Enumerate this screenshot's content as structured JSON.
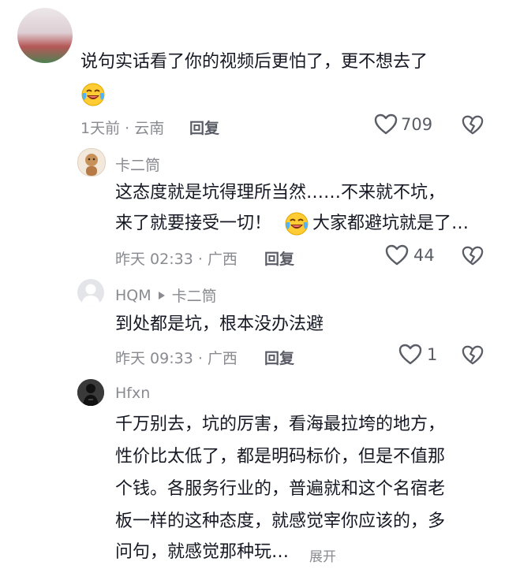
{
  "comments": [
    {
      "text_lines": [
        "说句实话看了你的视频后更怕了，更不想去了"
      ],
      "meta": "1天前 · 云南",
      "reply_label": "回复",
      "likes": "709",
      "emoji": "crying-laughing-emoji"
    },
    {
      "username": "卡二筒",
      "text_lines": [
        "这态度就是坑得理所当然……不来就不坑，",
        "来了就要接受一切！",
        "大家都避坑就是了…"
      ],
      "meta": "昨天 02:33 · 广西",
      "reply_label": "回复",
      "likes": "44",
      "emoji": "crying-laughing-emoji"
    },
    {
      "username": "HQM",
      "reply_to": "卡二筒",
      "text_lines": [
        "到处都是坑，根本没办法避"
      ],
      "meta": "昨天 09:33 · 广西",
      "reply_label": "回复",
      "likes": "1"
    },
    {
      "username": "Hfxn",
      "text_lines": [
        "千万别去，坑的厉害，看海最拉垮的地方，",
        "性价比太低了，都是明码标价，但是不值那",
        "个钱。各服务行业的，普遍就和这个名宿老",
        "板一样的这种态度，就感觉宰你应该的，多",
        "问句，就感觉那种玩…"
      ],
      "expand_label": "展开"
    }
  ],
  "icons": {
    "heart": "heart-outline-icon",
    "dislike": "broken-heart-icon",
    "arrow": "reply-arrow-icon"
  }
}
